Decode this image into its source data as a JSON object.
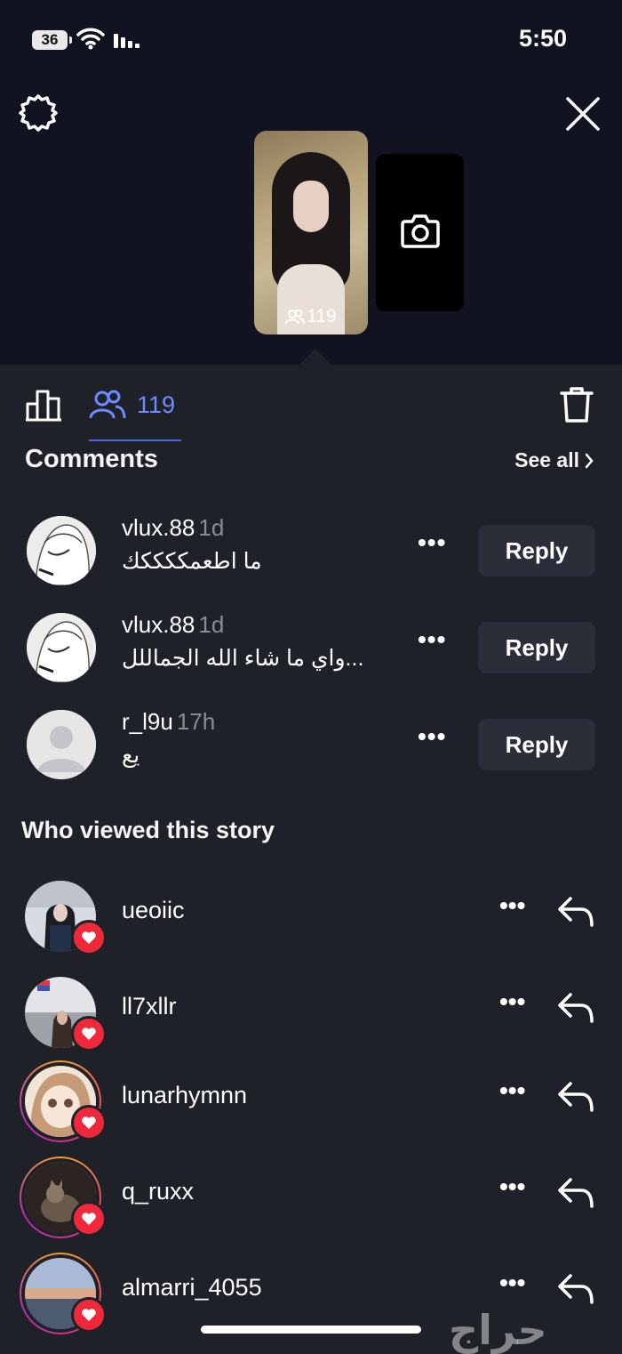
{
  "status": {
    "battery": "36",
    "time": "5:50"
  },
  "story": {
    "views": "119"
  },
  "tabs": {
    "viewer_count": "119"
  },
  "comments": {
    "title": "Comments",
    "see_all": "See all",
    "items": [
      {
        "user": "vlux.88",
        "time": "1d",
        "text": "ما اطعمككككك",
        "reply": "Reply"
      },
      {
        "user": "vlux.88",
        "time": "1d",
        "text": "واي ما شاء الله الجماللل...",
        "reply": "Reply"
      },
      {
        "user": "r_l9u",
        "time": "17h",
        "text": "يع",
        "reply": "Reply"
      }
    ]
  },
  "viewers": {
    "title": "Who viewed this story",
    "items": [
      {
        "name": "ueoiic"
      },
      {
        "name": "ll7xllr"
      },
      {
        "name": "lunarhymnn"
      },
      {
        "name": "q_ruxx"
      },
      {
        "name": "almarri_4055"
      }
    ]
  },
  "watermark": "حراج"
}
